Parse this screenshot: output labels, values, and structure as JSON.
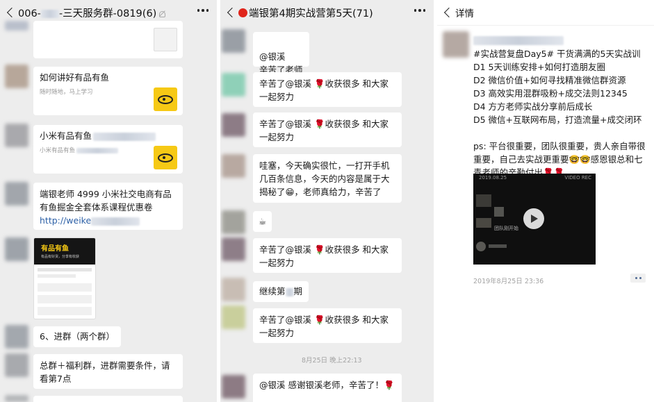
{
  "panel1": {
    "title": "006-",
    "title_rest": "-三天服务群-0819(6)",
    "messages": {
      "card_a_title": "如何讲好有品有鱼",
      "card_a_sub": "随时随地，马上学习",
      "card_b_title": "小米有品有鱼",
      "card_b_sub": "小米有品有鱼",
      "link_msg_text": "端银老师 4999 小米社交电商有品有鱼掘金全套体系课程优惠卷",
      "link_msg_url": "http://weike",
      "img_banner": "有品有鱼",
      "img_banner_sub": "有品有好货，分享有收获",
      "msg_six": "6、进群（两个群）",
      "msg_group": "总群＋福利群，进群需要条件，请看第7点"
    }
  },
  "panel2": {
    "title_icon": "red-dot-icon",
    "title": "端银第4期实战营第5天(71)",
    "messages": {
      "m1": "@银溪\n辛苦了老师",
      "m2_a": "辛苦了@银溪 ",
      "m2_b": "收获很多 和大家一起努力",
      "m3_a": "辛苦了@银溪 ",
      "m3_b": "收获很多 和大家一起努力",
      "m4_a": "哇塞，今天确实很忙，一打开手机几百条信息，今天的内容是属于大揭秘了",
      "m4_b": "，老师真给力，辛苦了",
      "m5": "☕",
      "m6_a": "辛苦了@银溪 ",
      "m6_b": "收获很多 和大家一起努力",
      "m7_a": "继续第",
      "m7_b": "期",
      "m8_a": "辛苦了@银溪 ",
      "m8_b": "收获很多 和大家一起努力",
      "timestamp": "8月25日 晚上22:13",
      "m9": "@银溪  感谢银溪老师，辛苦了！"
    }
  },
  "panel3": {
    "title": "详情",
    "post_lines": [
      "#实战营复盘Day5# 干货满满的5天实战训",
      "D1  5天训练安排+如何打造朋友圈",
      "D2  微信价值+如何寻找精准微信群资源",
      "D3 高效实用混群吸粉+成交法则12345",
      "D4 方方老师实战分享前后成长",
      "D5 微信+互联网布局，打造流量+成交闭环"
    ],
    "ps_text": "ps: 平台很重要，团队很重要，贵人亲自带很重要，自己去实战更重要",
    "ps_text2": "感恩银总和七青老师的辛勤付出",
    "video_date": "2019.08.25",
    "video_label": "VIDEO REC",
    "video_caption": "团队刚开始",
    "timestamp": "2019年8月25日 23:36"
  },
  "colors": {
    "bg": "#ededed",
    "bubble": "#ffffff",
    "link": "#2b5fa6",
    "accent_yellow": "#f6c915",
    "rose": "#d11c2a"
  }
}
